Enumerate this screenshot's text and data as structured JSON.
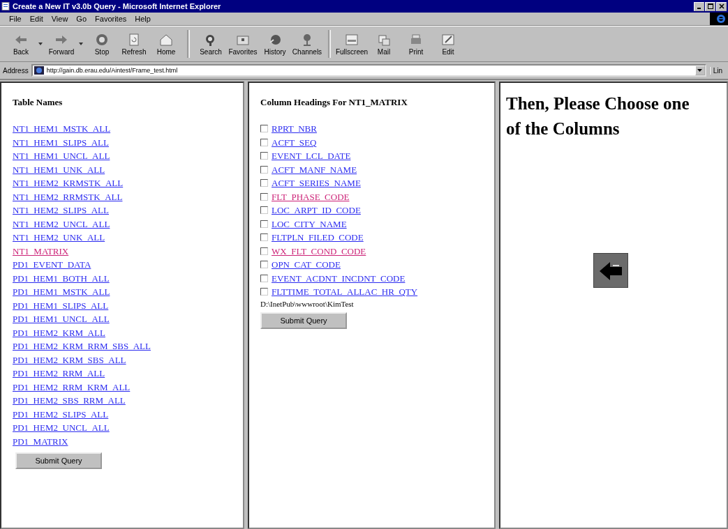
{
  "window": {
    "title": "Create a New IT v3.0b Query - Microsoft Internet Explorer"
  },
  "menu": [
    "File",
    "Edit",
    "View",
    "Go",
    "Favorites",
    "Help"
  ],
  "toolbar": [
    {
      "label": "Back",
      "dropdown": true
    },
    {
      "label": "Forward",
      "dropdown": true
    },
    {
      "label": "Stop",
      "dropdown": false
    },
    {
      "label": "Refresh",
      "dropdown": false
    },
    {
      "label": "Home",
      "dropdown": false
    },
    {
      "label": "Search",
      "dropdown": false
    },
    {
      "label": "Favorites",
      "dropdown": false
    },
    {
      "label": "History",
      "dropdown": false
    },
    {
      "label": "Channels",
      "dropdown": false
    },
    {
      "label": "Fullscreen",
      "dropdown": false
    },
    {
      "label": "Mail",
      "dropdown": false
    },
    {
      "label": "Print",
      "dropdown": false
    },
    {
      "label": "Edit",
      "dropdown": false
    }
  ],
  "address_bar": {
    "label": "Address",
    "value": "http://gain.db.erau.edu/Aintest/Frame_test.html",
    "links_label": "Lin"
  },
  "left_frame": {
    "heading": "Table Names",
    "tables": [
      {
        "name": "NT1_HEM1_MSTK_ALL",
        "visited": false
      },
      {
        "name": "NT1_HEM1_SLIPS_ALL",
        "visited": false
      },
      {
        "name": "NT1_HEM1_UNCL_ALL",
        "visited": false
      },
      {
        "name": "NT1_HEM1_UNK_ALL",
        "visited": false
      },
      {
        "name": "NT1_HEM2_KRMSTK_ALL",
        "visited": false
      },
      {
        "name": "NT1_HEM2_RRMSTK_ALL",
        "visited": false
      },
      {
        "name": "NT1_HEM2_SLIPS_ALL",
        "visited": false
      },
      {
        "name": "NT1_HEM2_UNCL_ALL",
        "visited": false
      },
      {
        "name": "NT1_HEM2_UNK_ALL",
        "visited": false
      },
      {
        "name": "NT1_MATRIX",
        "visited": true
      },
      {
        "name": "PD1_EVENT_DATA",
        "visited": false
      },
      {
        "name": "PD1_HEM1_BOTH_ALL",
        "visited": false
      },
      {
        "name": "PD1_HEM1_MSTK_ALL",
        "visited": false
      },
      {
        "name": "PD1_HEM1_SLIPS_ALL",
        "visited": false
      },
      {
        "name": "PD1_HEM1_UNCL_ALL",
        "visited": false
      },
      {
        "name": "PD1_HEM2_KRM_ALL",
        "visited": false
      },
      {
        "name": "PD1_HEM2_KRM_RRM_SBS_ALL",
        "visited": false
      },
      {
        "name": "PD1_HEM2_KRM_SBS_ALL",
        "visited": false
      },
      {
        "name": "PD1_HEM2_RRM_ALL",
        "visited": false
      },
      {
        "name": "PD1_HEM2_RRM_KRM_ALL",
        "visited": false
      },
      {
        "name": "PD1_HEM2_SBS_RRM_ALL",
        "visited": false
      },
      {
        "name": "PD1_HEM2_SLIPS_ALL",
        "visited": false
      },
      {
        "name": "PD1_HEM2_UNCL_ALL",
        "visited": false
      },
      {
        "name": "PD1_MATRIX",
        "visited": false
      }
    ],
    "submit": "Submit Query"
  },
  "middle_frame": {
    "heading": "Column Headings For NT1_MATRIX",
    "columns": [
      {
        "name": "RPRT_NBR",
        "checked": false,
        "visited": false
      },
      {
        "name": "ACFT_SEQ",
        "checked": false,
        "visited": false
      },
      {
        "name": "EVENT_LCL_DATE",
        "checked": false,
        "visited": false
      },
      {
        "name": "ACFT_MANF_NAME",
        "checked": false,
        "visited": false
      },
      {
        "name": "ACFT_SERIES_NAME",
        "checked": false,
        "visited": false
      },
      {
        "name": "FLT_PHASE_CODE",
        "checked": false,
        "visited": true
      },
      {
        "name": "LOC_ARPT_ID_CODE",
        "checked": false,
        "visited": false
      },
      {
        "name": "LOC_CITY_NAME",
        "checked": false,
        "visited": false
      },
      {
        "name": "FLTPLN_FILED_CODE",
        "checked": false,
        "visited": false
      },
      {
        "name": "WX_FLT_COND_CODE",
        "checked": false,
        "visited": true
      },
      {
        "name": "OPN_CAT_CODE",
        "checked": false,
        "visited": false
      },
      {
        "name": "EVENT_ACDNT_INCDNT_CODE",
        "checked": false,
        "visited": false
      },
      {
        "name": "FLTTIME_TOTAL_ALLAC_HR_QTY",
        "checked": false,
        "visited": false
      }
    ],
    "path": "D:\\InetPub\\wwwroot\\KimTest",
    "submit": "Submit Query"
  },
  "right_frame": {
    "heading": "Then, Please Choose one of the Columns"
  }
}
